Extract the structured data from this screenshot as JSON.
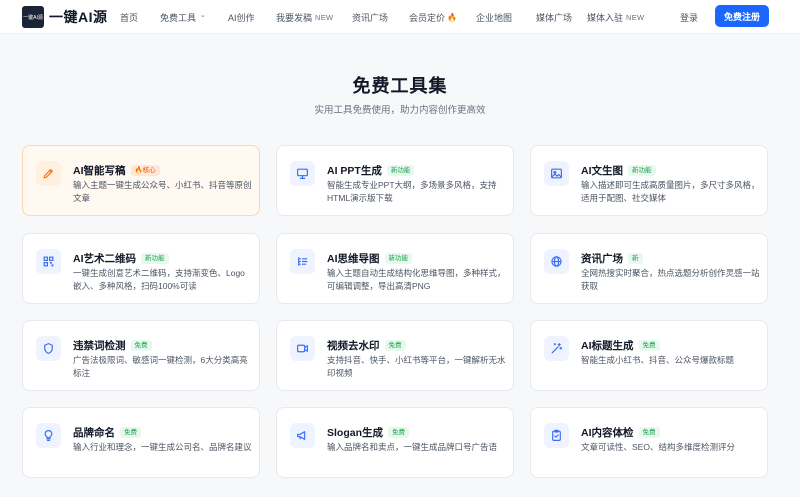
{
  "brand": {
    "logo_mark_text": "一键AI源",
    "name": "一键AI源"
  },
  "nav": {
    "items": [
      {
        "label": "首页"
      },
      {
        "label": "免费工具",
        "dropdown": true
      },
      {
        "label": "AI创作"
      },
      {
        "label": "我要发稿",
        "badge": "NEW"
      },
      {
        "label": "资讯广场"
      },
      {
        "label": "会员定价",
        "fire": true
      },
      {
        "label": "企业地图"
      },
      {
        "label": "媒体广场"
      },
      {
        "label": "媒体入驻",
        "badge": "NEW"
      }
    ],
    "login": "登录",
    "register": "免费注册"
  },
  "header": {
    "title": "免费工具集",
    "subtitle": "实用工具免费使用，助力内容创作更高效"
  },
  "cards": [
    {
      "title": "AI智能写稿",
      "tag": "🔥核心",
      "tag_type": "hot",
      "icon": "pen-icon",
      "desc": "输入主题一键生成公众号、小红书、抖音等原创文章"
    },
    {
      "title": "AI PPT生成",
      "tag": "新功能",
      "tag_type": "new",
      "icon": "presentation-icon",
      "desc": "智能生成专业PPT大纲，多场景多风格，支持HTML演示版下载"
    },
    {
      "title": "AI文生图",
      "tag": "新功能",
      "tag_type": "new",
      "icon": "image-icon",
      "desc": "输入描述即可生成高质量图片，多尺寸多风格，适用于配图、社交媒体"
    },
    {
      "title": "AI艺术二维码",
      "tag": "新功能",
      "tag_type": "new",
      "icon": "qrcode-icon",
      "desc": "一键生成创意艺术二维码，支持渐变色、Logo嵌入、多种风格，扫码100%可读"
    },
    {
      "title": "AI思维导图",
      "tag": "新功能",
      "tag_type": "new",
      "icon": "mindmap-icon",
      "desc": "输入主题自动生成结构化思维导图，多种样式，可编辑调整，导出高清PNG"
    },
    {
      "title": "资讯广场",
      "tag": "新",
      "tag_type": "new",
      "icon": "globe-icon",
      "desc": "全网热搜实时聚合，热点选题分析创作灵感一站获取"
    },
    {
      "title": "违禁词检测",
      "tag": "免费",
      "tag_type": "free",
      "icon": "shield-icon",
      "desc": "广告法极限词、敏感词一键检测，6大分类高亮标注"
    },
    {
      "title": "视频去水印",
      "tag": "免费",
      "tag_type": "free",
      "icon": "video-icon",
      "desc": "支持抖音、快手、小红书等平台，一键解析无水印视频"
    },
    {
      "title": "AI标题生成",
      "tag": "免费",
      "tag_type": "free",
      "icon": "magic-wand-icon",
      "desc": "智能生成小红书、抖音、公众号爆款标题"
    },
    {
      "title": "品牌命名",
      "tag": "免费",
      "tag_type": "free",
      "icon": "lightbulb-icon",
      "desc": "输入行业和理念，一键生成公司名、品牌名建议"
    },
    {
      "title": "Slogan生成",
      "tag": "免费",
      "tag_type": "free",
      "icon": "megaphone-icon",
      "desc": "输入品牌名和卖点，一键生成品牌口号广告语"
    },
    {
      "title": "AI内容体检",
      "tag": "免费",
      "tag_type": "free",
      "icon": "clipboard-check-icon",
      "desc": "文章可读性、SEO、结构多维度检测评分"
    }
  ],
  "colors": {
    "accent": "#1a66ff",
    "icon_blue": "#3b6ff5",
    "icon_orange": "#f97316",
    "tag_green": "#16a34a",
    "tag_hot": "#ea580c"
  }
}
